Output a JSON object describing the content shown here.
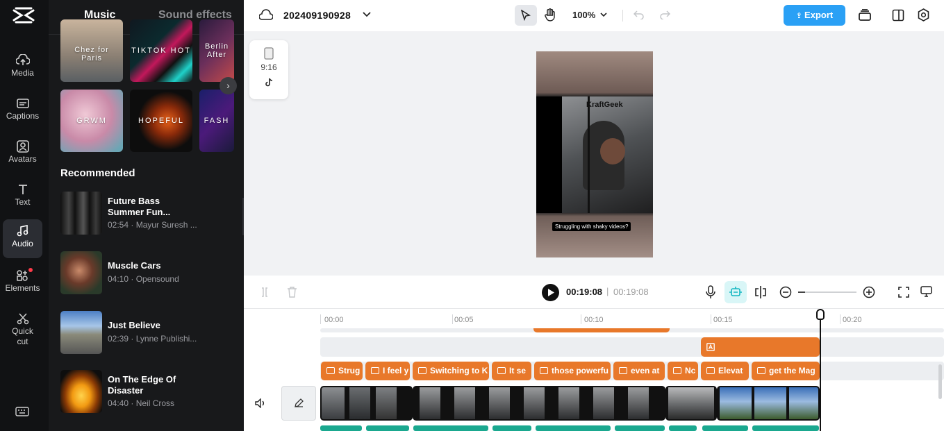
{
  "rail": {
    "items": [
      {
        "label": "Media",
        "icon": "cloud-upload-icon"
      },
      {
        "label": "Captions",
        "icon": "captions-icon"
      },
      {
        "label": "Avatars",
        "icon": "avatar-icon"
      },
      {
        "label": "Text",
        "icon": "text-icon"
      },
      {
        "label": "Audio",
        "icon": "music-note-icon",
        "active": true
      },
      {
        "label": "Elements",
        "icon": "elements-icon"
      },
      {
        "label": "Quick cut",
        "icon": "scissors-icon"
      }
    ]
  },
  "panel": {
    "tabs": [
      {
        "label": "Music",
        "active": true
      },
      {
        "label": "Sound effects"
      }
    ],
    "tiles_row1": [
      {
        "label": "Chez for Paris"
      },
      {
        "label": "TIKTOK HOT"
      },
      {
        "label": "Berlin After"
      }
    ],
    "tiles_row2": [
      {
        "label": "GRWM"
      },
      {
        "label": "HOPEFUL"
      },
      {
        "label": "FASH"
      }
    ],
    "recommended_title": "Recommended",
    "tracks": [
      {
        "name": "Future Bass Summer Fun...",
        "meta": "02:54 · Mayur Suresh ..."
      },
      {
        "name": "Muscle Cars",
        "meta": "04:10 · Opensound"
      },
      {
        "name": "Just Believe",
        "meta": "02:39 · Lynne Publishi..."
      },
      {
        "name": "On The Edge Of Disaster",
        "meta": "04:40 · Neil Cross"
      }
    ]
  },
  "topbar": {
    "project_name": "202409190928",
    "zoom": "100%",
    "export_label": "Export"
  },
  "canvas": {
    "ratio_label": "9:16",
    "video_brand": "KraftGeek",
    "video_caption": "Struggling with shaky videos?"
  },
  "timeline": {
    "current_time": "00:19:08",
    "separator": "|",
    "total_time": "00:19:08",
    "ruler": [
      "00:00",
      "00:05",
      "00:10",
      "00:15",
      "00:20"
    ],
    "captions": [
      "Strug",
      "I feel y",
      "Switching to K",
      "It se",
      "those powerfu",
      "even at",
      "Nc",
      "Elevat",
      "get the Mag"
    ]
  },
  "colors": {
    "accent": "#21d0d9",
    "track_orange": "#e8782a",
    "export_blue": "#2aa0f5"
  }
}
